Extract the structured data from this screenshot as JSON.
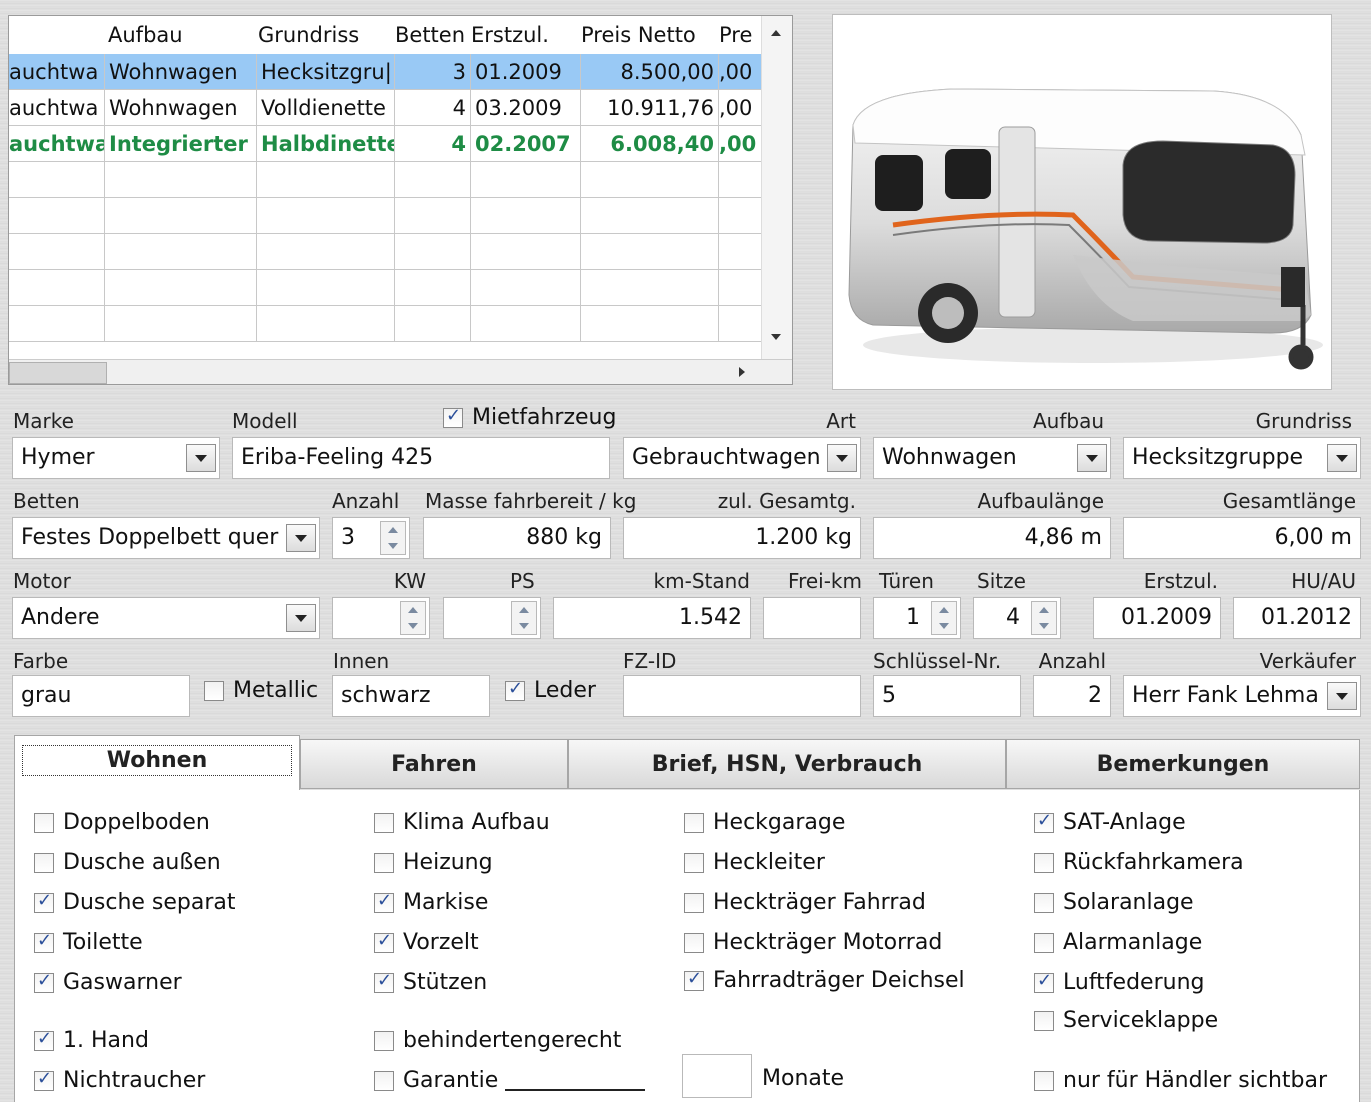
{
  "grid": {
    "columns": [
      "",
      "Aufbau",
      "Grundriss",
      "Betten",
      "Erstzul.",
      "Preis Netto",
      "Pre"
    ],
    "rows": [
      {
        "art": "auchtwa",
        "aufbau": "Wohnwagen",
        "grundriss": "Hecksitzgru|",
        "betten": "3",
        "erstzul": "01.2009",
        "preis": "8.500,00",
        "pre": ",00",
        "state": "selected"
      },
      {
        "art": "auchtwa",
        "aufbau": "Wohnwagen",
        "grundriss": "Volldienette",
        "betten": "4",
        "erstzul": "03.2009",
        "preis": "10.911,76",
        "pre": ",00",
        "state": "normal"
      },
      {
        "art": "auchtwa",
        "aufbau": "Integrierter",
        "grundriss": "Halbdinette",
        "betten": "4",
        "erstzul": "02.2007",
        "preis": "6.008,40",
        "pre": ",00",
        "state": "green"
      }
    ],
    "selected_color": "#99c9f5",
    "green_color": "#1e8c45"
  },
  "form": {
    "marke": {
      "label": "Marke",
      "value": "Hymer"
    },
    "modell": {
      "label": "Modell",
      "value": "Eriba-Feeling 425"
    },
    "mietfahrzeug": {
      "label": "Mietfahrzeug",
      "checked": true
    },
    "art": {
      "label": "Art",
      "value": "Gebrauchtwagen"
    },
    "aufbau": {
      "label": "Aufbau",
      "value": "Wohnwagen"
    },
    "grundriss": {
      "label": "Grundriss",
      "value": "Hecksitzgruppe"
    },
    "betten": {
      "label": "Betten",
      "value": "Festes Doppelbett quer"
    },
    "anzahl": {
      "label": "Anzahl",
      "value": "3"
    },
    "masse": {
      "label": "Masse fahrbereit / kg",
      "value": "880 kg"
    },
    "gesamtg": {
      "label": "zul. Gesamtg.",
      "value": "1.200 kg"
    },
    "aufbaulaenge": {
      "label": "Aufbaulänge",
      "value": "4,86 m"
    },
    "gesamtlaenge": {
      "label": "Gesamtlänge",
      "value": "6,00 m"
    },
    "motor": {
      "label": "Motor",
      "value": "Andere"
    },
    "kw": {
      "label": "KW",
      "value": ""
    },
    "ps": {
      "label": "PS",
      "value": ""
    },
    "kmstand": {
      "label": "km-Stand",
      "value": "1.542"
    },
    "freikm": {
      "label": "Frei-km",
      "value": ""
    },
    "tueren": {
      "label": "Türen",
      "value": "1"
    },
    "sitze": {
      "label": "Sitze",
      "value": "4"
    },
    "erstzul": {
      "label": "Erstzul.",
      "value": "01.2009"
    },
    "huau": {
      "label": "HU/AU",
      "value": "01.2012"
    },
    "farbe": {
      "label": "Farbe",
      "value": "grau"
    },
    "metallic": {
      "label": "Metallic",
      "checked": false
    },
    "innen": {
      "label": "Innen",
      "value": "schwarz"
    },
    "leder": {
      "label": "Leder",
      "checked": true
    },
    "fzid": {
      "label": "FZ-ID",
      "value": ""
    },
    "schluessel": {
      "label": "Schlüssel-Nr.",
      "value": "5"
    },
    "anzahl2": {
      "label": "Anzahl",
      "value": "2"
    },
    "verkaeufer": {
      "label": "Verkäufer",
      "value": "Herr Fank Lehma"
    }
  },
  "tabs": [
    "Wohnen",
    "Fahren",
    "Brief, HSN, Verbrauch",
    "Bemerkungen"
  ],
  "active_tab": "Wohnen",
  "features": {
    "col1": [
      {
        "label": "Doppelboden",
        "checked": false
      },
      {
        "label": "Dusche außen",
        "checked": false
      },
      {
        "label": "Dusche separat",
        "checked": true
      },
      {
        "label": "Toilette",
        "checked": true
      },
      {
        "label": "Gaswarner",
        "checked": true
      }
    ],
    "col2": [
      {
        "label": "Klima Aufbau",
        "checked": false
      },
      {
        "label": "Heizung",
        "checked": false
      },
      {
        "label": "Markise",
        "checked": true
      },
      {
        "label": "Vorzelt",
        "checked": true
      },
      {
        "label": "Stützen",
        "checked": true
      }
    ],
    "col3": [
      {
        "label": "Heckgarage",
        "checked": false
      },
      {
        "label": "Heckleiter",
        "checked": false
      },
      {
        "label": "Heckträger Fahrrad",
        "checked": false
      },
      {
        "label": "Heckträger Motorrad",
        "checked": false
      },
      {
        "label": "Fahrradträger Deichsel",
        "checked": true
      }
    ],
    "col4": [
      {
        "label": "SAT-Anlage",
        "checked": true
      },
      {
        "label": "Rückfahrkamera",
        "checked": false
      },
      {
        "label": "Solaranlage",
        "checked": false
      },
      {
        "label": "Alarmanlage",
        "checked": false
      },
      {
        "label": "Luftfederung",
        "checked": true
      },
      {
        "label": "Serviceklappe",
        "checked": false
      }
    ],
    "erste_hand": {
      "label": "1. Hand",
      "checked": true
    },
    "nichtraucher": {
      "label": "Nichtraucher",
      "checked": true
    },
    "behinderten": {
      "label": "behindertengerecht",
      "checked": false
    },
    "garantie": {
      "label": "Garantie",
      "checked": false
    },
    "monate": {
      "label": "Monate",
      "value": ""
    },
    "haendler": {
      "label": "nur für Händler sichtbar",
      "checked": false
    }
  }
}
